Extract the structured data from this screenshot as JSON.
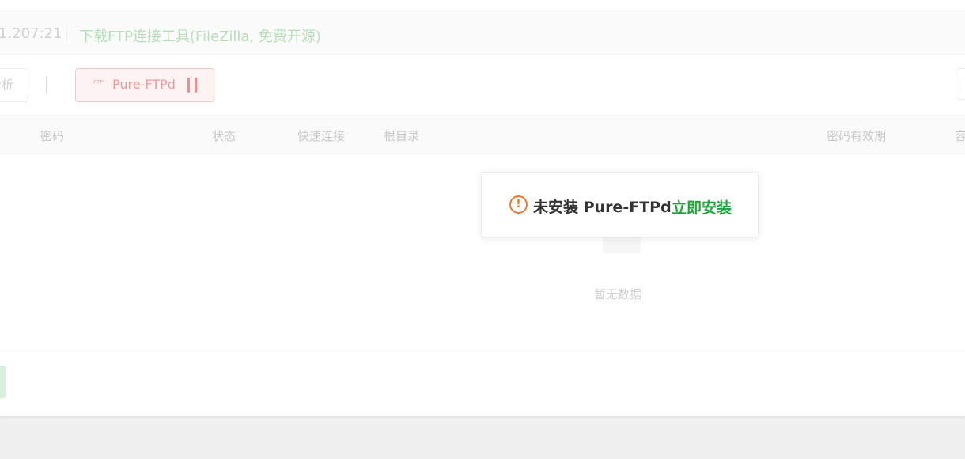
{
  "header": {
    "ip_text": "1.207:21",
    "ftp_tool_link": "下载FTP连接工具(FileZilla, 免费开源)"
  },
  "toolbar": {
    "analyze_label": "分析",
    "service_icon_text": "FTP",
    "service_name": "Pure-FTPd",
    "service_status": "paused"
  },
  "table": {
    "columns": [
      "密码",
      "状态",
      "快速连接",
      "根目录",
      "密码有效期",
      "容"
    ],
    "rows": [],
    "empty_text": "暂无数据"
  },
  "alert": {
    "message": "未安装 Pure-FTPd",
    "action_label": "立即安装",
    "icon": "exclamation-circle-icon"
  },
  "colors": {
    "accent_green": "#20a53a",
    "warning_orange": "#ef7a2d",
    "service_red": "#ef9a9a"
  }
}
